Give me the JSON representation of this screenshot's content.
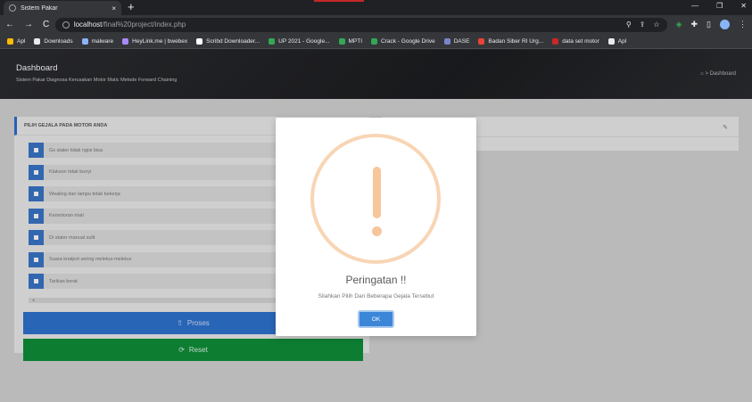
{
  "browser": {
    "tab_title": "Sistem Pakar",
    "tab_close": "×",
    "new_tab": "+",
    "window_controls": [
      "—",
      "❐",
      "✕"
    ],
    "nav": [
      "←",
      "→",
      "C"
    ],
    "url_host": "localhost",
    "url_path": "/final%20project/index.php",
    "omni_icons": [
      "⚲",
      "⇪",
      "☆"
    ],
    "extensions": [
      "◈",
      "✚",
      "▯",
      "⋮"
    ]
  },
  "bookmarks": [
    {
      "label": "Apl",
      "color": "#fbbc04"
    },
    {
      "label": "Downloads",
      "color": "#e8eaed"
    },
    {
      "label": "malware",
      "color": "#8ab4f8"
    },
    {
      "label": "HeyLink.me | bwebex",
      "color": "#a78bfa"
    },
    {
      "label": "Scribd Downloader...",
      "color": "#ffffff"
    },
    {
      "label": "UP 2021 - Google...",
      "color": "#34a853"
    },
    {
      "label": "MPTI",
      "color": "#34a853"
    },
    {
      "label": "Crack - Google Drive",
      "color": "#34a853"
    },
    {
      "label": "DASE",
      "color": "#7986cb"
    },
    {
      "label": "Badan Siber RI Urg...",
      "color": "#ea4335"
    },
    {
      "label": "data set motor",
      "color": "#c62828"
    },
    {
      "label": "Apl",
      "color": "#e8eaed"
    }
  ],
  "header": {
    "title": "Dashboard",
    "subtitle": "Sistem Pakar Diagnosa Kerusakan Motor Matic Metode Forward Chaining",
    "breadcrumb": "⌂ > Dashboard"
  },
  "card": {
    "heading": "PILIH GEJALA PADA MOTOR ANDA",
    "symptoms": [
      "Gs stater tidak ngisi bisa",
      "Klakson tidak bunyi",
      "Wealing dan lampu tidak bekerja",
      "Kemotoran mati",
      "Di stater manual sulit",
      "Suara knalpot sering meletus-meletus",
      "Tarikan berat"
    ],
    "scroll_glyph": "◂",
    "proses_label": "Proses",
    "proses_icon": "⇧",
    "reset_label": "Reset",
    "reset_icon": "⟳"
  },
  "card2": {
    "edit_glyph": "✎"
  },
  "modal": {
    "title": "Peringatan !!",
    "message": "Silahkan Pilih Dari Beberapa Gejala Tersebut",
    "ok_label": "OK"
  },
  "colors": {
    "primary": "#2f73d1",
    "success": "#0f8f3a",
    "warning": "#f7c69b"
  }
}
